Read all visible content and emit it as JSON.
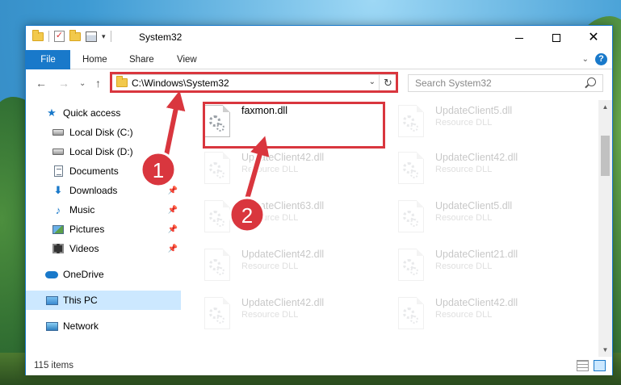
{
  "window": {
    "title": "System32",
    "controls": {
      "minimize": "minimize",
      "maximize": "maximize",
      "close": "close"
    }
  },
  "ribbon": {
    "tabs": [
      "File",
      "Home",
      "Share",
      "View"
    ]
  },
  "address": {
    "path": "C:\\Windows\\System32"
  },
  "search": {
    "placeholder": "Search System32"
  },
  "nav": {
    "items": [
      {
        "label": "Quick access",
        "icon": "star-icon"
      },
      {
        "label": "Local Disk (C:)",
        "icon": "drive-icon"
      },
      {
        "label": "Local Disk (D:)",
        "icon": "drive-icon"
      },
      {
        "label": "Documents",
        "icon": "documents-icon"
      },
      {
        "label": "Downloads",
        "icon": "download-icon"
      },
      {
        "label": "Music",
        "icon": "music-icon"
      },
      {
        "label": "Pictures",
        "icon": "pictures-icon"
      },
      {
        "label": "Videos",
        "icon": "videos-icon"
      },
      {
        "label": "OneDrive",
        "icon": "cloud-icon"
      },
      {
        "label": "This PC",
        "icon": "computer-icon",
        "selected": true
      },
      {
        "label": "Network",
        "icon": "network-icon"
      }
    ]
  },
  "files": [
    {
      "name": "faxmon.dll",
      "type": ""
    },
    {
      "name": "UpdateClient5.dll",
      "type": "Resource DLL"
    },
    {
      "name": "UpdateClient42.dll",
      "type": "Resource DLL"
    },
    {
      "name": "UpdateClient42.dll",
      "type": "Resource DLL"
    },
    {
      "name": "UpdateClient63.dll",
      "type": "Resource DLL"
    },
    {
      "name": "UpdateClient5.dll",
      "type": "Resource DLL"
    },
    {
      "name": "UpdateClient42.dll",
      "type": "Resource DLL"
    },
    {
      "name": "UpdateClient21.dll",
      "type": "Resource DLL"
    },
    {
      "name": "UpdateClient42.dll",
      "type": "Resource DLL"
    },
    {
      "name": "UpdateClient42.dll",
      "type": "Resource DLL"
    }
  ],
  "status": {
    "count": "115 items"
  },
  "annotations": {
    "step1": "1",
    "step2": "2",
    "color": "#d9363e"
  }
}
